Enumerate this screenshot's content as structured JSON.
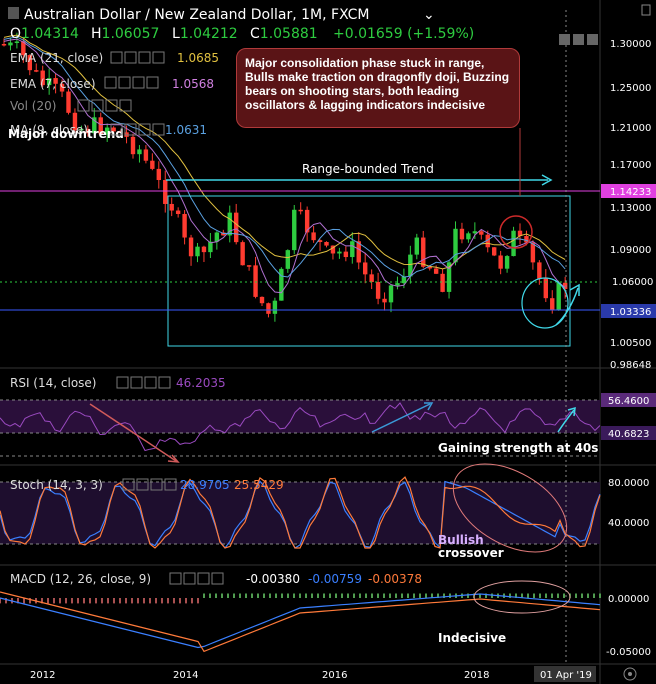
{
  "header": {
    "title": "Australian Dollar / New Zealand Dollar, 1M, FXCM",
    "ohlc": {
      "o_label": "O",
      "o": "1.04314",
      "h_label": "H",
      "h": "1.06057",
      "l_label": "L",
      "l": "1.04212",
      "c_label": "C",
      "c": "1.05881",
      "chg": "+0.01659 (+1.59%)"
    }
  },
  "indicators": {
    "ema21": {
      "label": "EMA (21, close)",
      "value": "1.0685"
    },
    "ema7": {
      "label": "EMA (7, close)",
      "value": "1.0568"
    },
    "vol": {
      "label": "Vol (20)"
    },
    "ma": {
      "label": "MA (9, close)",
      "value": "1.0631"
    }
  },
  "annotations": {
    "callout": "Major consolidation phase stuck in range, Bulls make traction on dragonfly doji, Buzzing bears on shooting stars, both leading oscillators & lagging indicators indecisive",
    "major_downtrend": "Major downtrend",
    "range_trend": "Range-bounded Trend",
    "rsi_note": "Gaining strength at 40s",
    "stoch_note_1": "Bullish",
    "stoch_note_2": "crossover",
    "macd_note": "Indecisive"
  },
  "price_axis": {
    "ticks": [
      "1.30000",
      "1.25000",
      "1.21000",
      "1.17000",
      "1.13000",
      "1.09000",
      "1.06000",
      "1.00500"
    ],
    "tags": {
      "resistance": "1.14233",
      "support": "1.03336",
      "bottom": "0.98648"
    }
  },
  "rsi": {
    "label": "RSI (14, close)",
    "value": "46.2035",
    "ticks": [
      "56.4600",
      "40.6823"
    ]
  },
  "stoch": {
    "label": "Stoch (14, 3, 3)",
    "k": "28.9705",
    "d": "25.5429",
    "ticks": [
      "80.0000",
      "40.0000"
    ]
  },
  "macd": {
    "label": "MACD (12, 26, close, 9)",
    "hist": "-0.00380",
    "macd": "-0.00759",
    "signal": "-0.00378",
    "ticks": [
      "0.00000",
      "-0.05000"
    ]
  },
  "time_axis": {
    "labels": [
      "2012",
      "2014",
      "2016",
      "2018"
    ],
    "current": "01 Apr '19"
  },
  "colors": {
    "bull": "#2ecc40",
    "bear": "#ff3b30",
    "ema21": "#e0c040",
    "ema7": "#b070d0",
    "ma": "#5aa0e0",
    "cyan": "#40d8e8",
    "magenta": "#e040e0",
    "stochK": "#3a7fff",
    "stochD": "#ff7a3a",
    "macd": "#3a7fff",
    "signal": "#ff7a3a"
  },
  "chart_data": {
    "type": "candlestick",
    "title": "Australian Dollar / New Zealand Dollar, 1M, FXCM",
    "price_range": [
      0.98,
      1.32
    ],
    "candles_count": 88,
    "key_levels": {
      "range_top": 1.14233,
      "range_bottom": 1.03336
    },
    "last": {
      "open": 1.04314,
      "high": 1.06057,
      "low": 1.04212,
      "close": 1.05881,
      "change": 0.01659,
      "change_pct": 1.59
    },
    "ema21": 1.0685,
    "ema7": 1.0568,
    "ma9": 1.0631,
    "rsi14": 46.2035,
    "stoch": {
      "k": 28.9705,
      "d": 25.5429
    },
    "macd": {
      "histogram": -0.0038,
      "macd": -0.00759,
      "signal": -0.00378
    }
  }
}
